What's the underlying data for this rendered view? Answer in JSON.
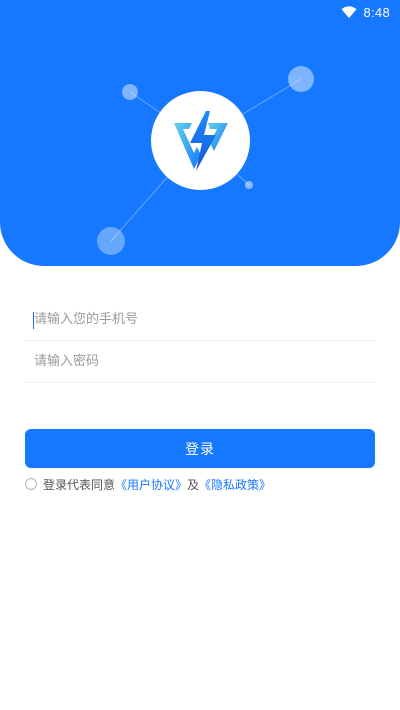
{
  "status_bar": {
    "time": "8:48",
    "wifi_icon": "wifi-icon"
  },
  "colors": {
    "primary": "#1677ff",
    "text_muted": "#9a9a9a",
    "link": "#1677ff"
  },
  "logo": {
    "icon": "lightning-triangle-logo-icon"
  },
  "form": {
    "phone_placeholder": "请输入您的手机号",
    "password_placeholder": "请输入密码",
    "login_label": "登录"
  },
  "agreement": {
    "prefix": "登录代表同意",
    "user_agreement": "《用户协议》",
    "connector": "及",
    "privacy_policy": "《隐私政策》"
  }
}
